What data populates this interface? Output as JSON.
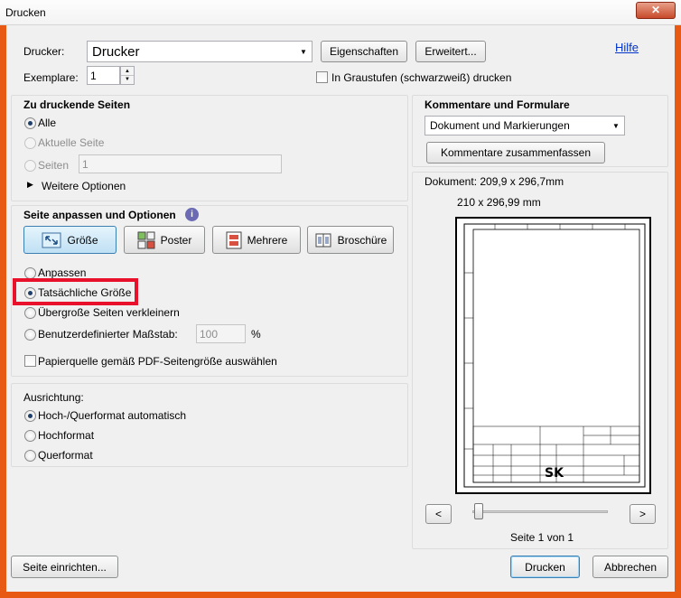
{
  "window": {
    "title": "Drucken"
  },
  "printer": {
    "label": "Drucker:",
    "selected": "Drucker",
    "properties_button": "Eigenschaften",
    "advanced_button": "Erweitert...",
    "help_link": "Hilfe",
    "copies_label": "Exemplare:",
    "copies_value": "1",
    "grayscale_label": "In Graustufen (schwarzweiß) drucken"
  },
  "pages": {
    "heading": "Zu druckende Seiten",
    "all": "Alle",
    "current": "Aktuelle Seite",
    "pages": "Seiten",
    "pages_value": "1",
    "more_options": "Weitere Optionen"
  },
  "sizing": {
    "heading": "Seite anpassen und Optionen",
    "tabs": [
      "Größe",
      "Poster",
      "Mehrere",
      "Broschüre"
    ],
    "fit": "Anpassen",
    "actual_size": "Tatsächliche Größe",
    "shrink": "Übergroße Seiten verkleinern",
    "custom_scale": "Benutzerdefinierter Maßstab:",
    "custom_scale_value": "100",
    "percent": "%",
    "paper_source": "Papierquelle gemäß PDF-Seitengröße auswählen"
  },
  "orientation": {
    "heading": "Ausrichtung:",
    "auto": "Hoch-/Querformat automatisch",
    "portrait": "Hochformat",
    "landscape": "Querformat"
  },
  "comments": {
    "heading": "Kommentare und Formulare",
    "selected": "Dokument und Markierungen",
    "summarize_button": "Kommentare zusammenfassen"
  },
  "preview": {
    "document_size": "Dokument: 209,9 x 296,7mm",
    "paper_size": "210 x 296,99 mm",
    "prev": "<",
    "next": ">",
    "page_indicator": "Seite 1 von 1",
    "title_block_logo": "SK"
  },
  "footer": {
    "page_setup": "Seite einrichten...",
    "print": "Drucken",
    "cancel": "Abbrechen"
  }
}
